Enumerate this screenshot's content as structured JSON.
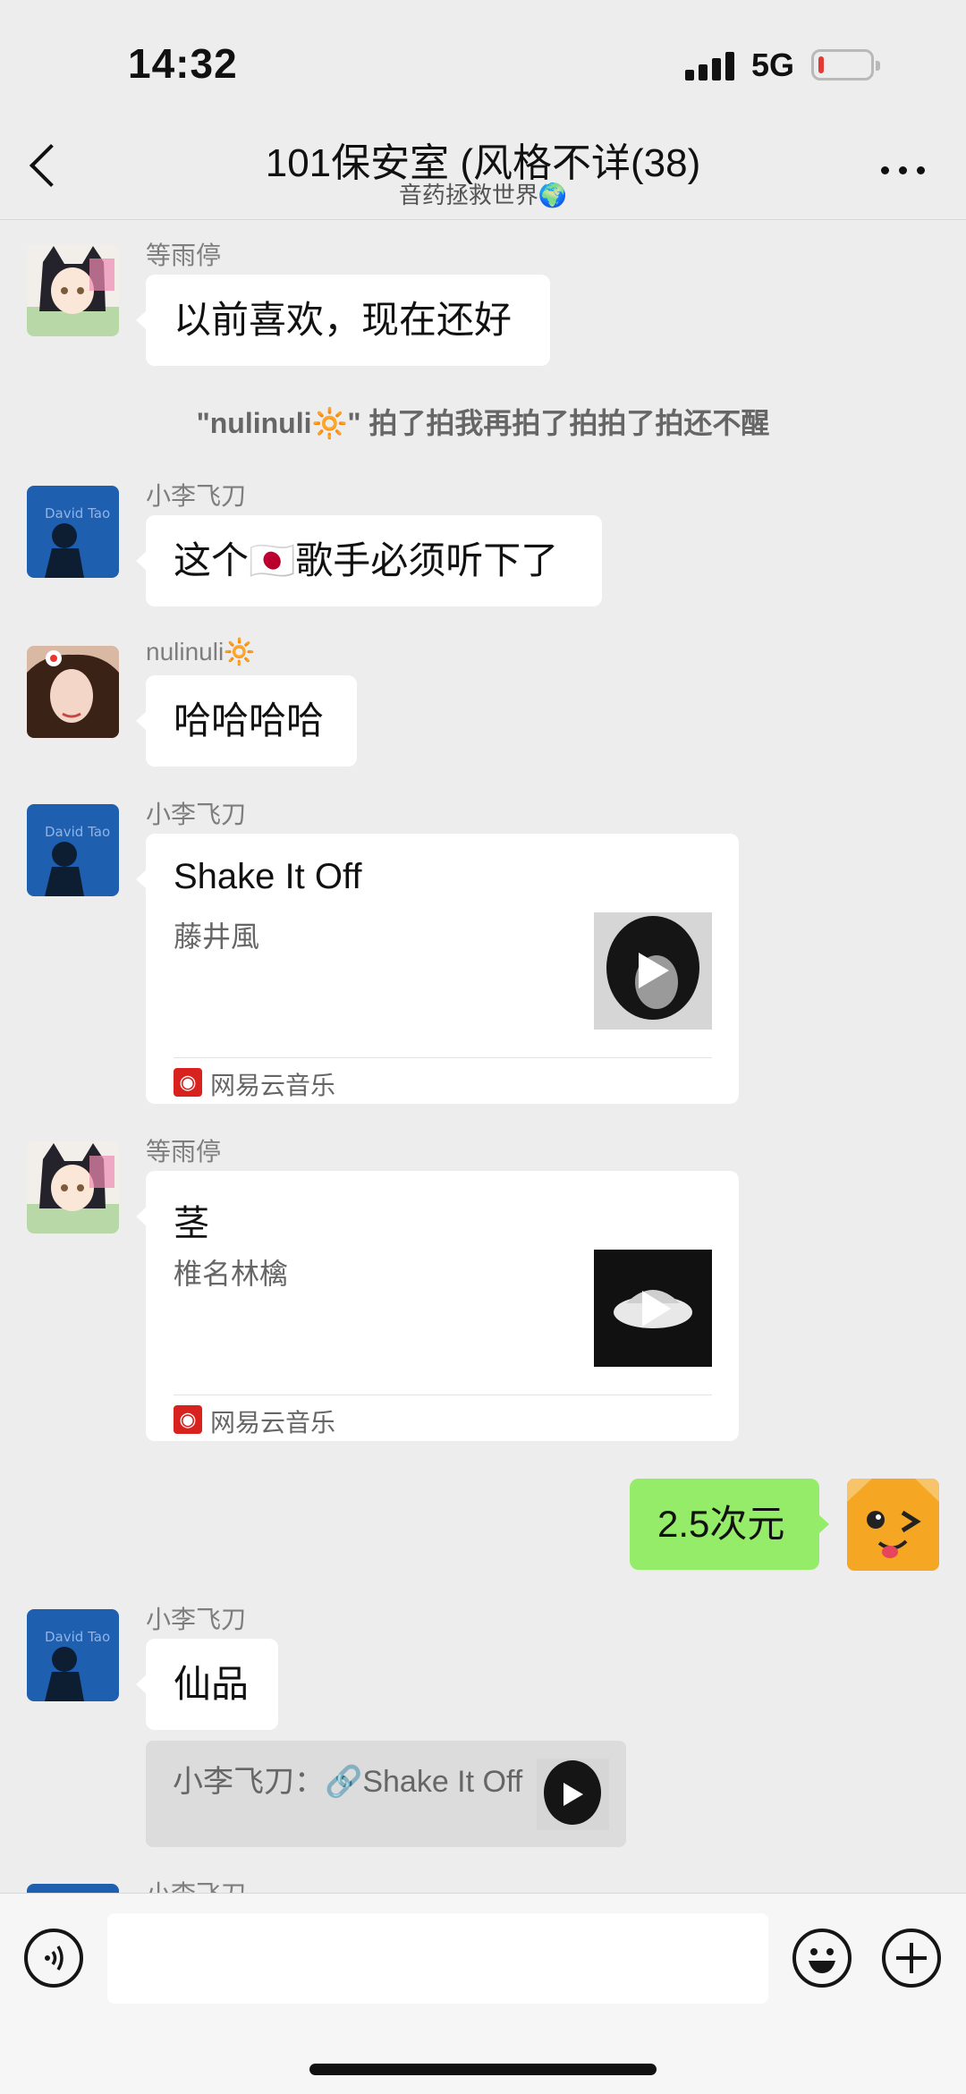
{
  "status_bar": {
    "time": "14:32",
    "network": "5G",
    "battery_level": 0.1
  },
  "header": {
    "title": "101保安室 (风格不详(38)",
    "subtitle": "音药拯救世界🌍"
  },
  "messages": [
    {
      "sender": "等雨停",
      "text": "以前喜欢，现在还好"
    },
    {
      "system": "\"nulinuli🔆\" 拍了拍我再拍了拍拍了拍还不醒"
    },
    {
      "sender": "小李飞刀",
      "text": "这个🇯🇵歌手必须听下了"
    },
    {
      "sender": "nulinuli🔆",
      "text": "哈哈哈哈"
    },
    {
      "sender": "小李飞刀",
      "music": {
        "title": "Shake It Off",
        "artist": "藤井風",
        "source": "网易云音乐"
      }
    },
    {
      "sender": "等雨停",
      "music": {
        "title": "茎",
        "artist": "椎名林檎",
        "source": "网易云音乐"
      }
    },
    {
      "sender": "me",
      "text": "2.5次元"
    },
    {
      "sender": "小李飞刀",
      "text": "仙品",
      "quote": "小李飞刀：🔗Shake It Off"
    }
  ],
  "partial_sender": "小李飞刀",
  "icons": {
    "back": "chevron-left-icon",
    "more": "more-icon",
    "voice": "voice-icon",
    "emoji": "emoji-icon",
    "plus": "plus-icon",
    "play": "play-icon",
    "music_source": "netease-music-icon"
  },
  "colors": {
    "background": "#ededed",
    "my_bubble": "#95ec69",
    "other_bubble": "#ffffff",
    "netease_red": "#d8221e"
  }
}
